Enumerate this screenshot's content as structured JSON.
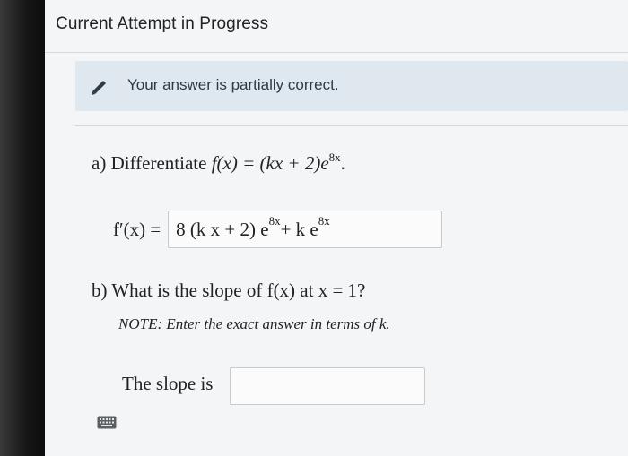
{
  "header": {
    "title": "Current Attempt in Progress"
  },
  "feedback": {
    "icon": "pencil-icon",
    "message": "Your answer is partially correct.",
    "color": "#dfe8ee"
  },
  "question_a": {
    "label": "a) Differentiate",
    "function": "f(x) = (kx + 2)e",
    "exponent": "8x",
    "end": ".",
    "derivative_lhs": "f′(x) =",
    "answer_main": "8 (k x + 2) e",
    "answer_exp1": "8x",
    "answer_mid": " + k e",
    "answer_exp2": "8x"
  },
  "question_b": {
    "label": "b) What is the slope of f(x) at x = 1?",
    "note": "NOTE: Enter the exact answer in terms of k.",
    "slope_label": "The slope is",
    "slope_value": ""
  },
  "toolbar": {
    "keyboard_icon": "keyboard-icon"
  }
}
